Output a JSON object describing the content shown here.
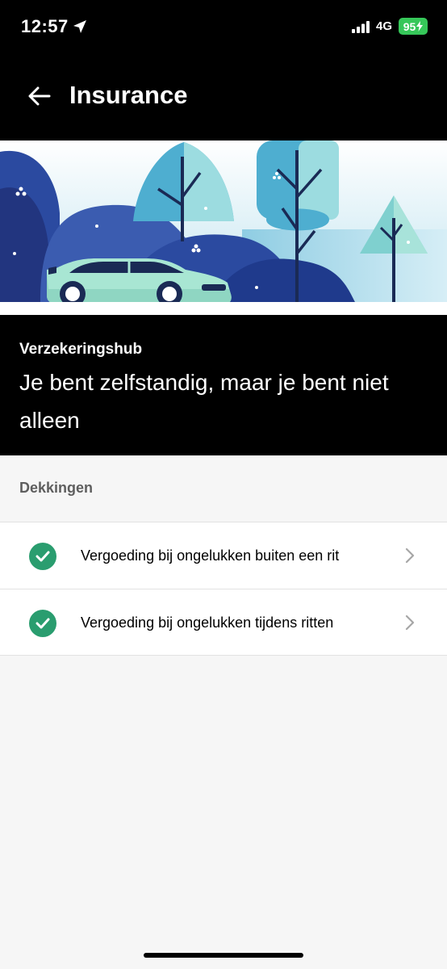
{
  "status_bar": {
    "time": "12:57",
    "network": "4G",
    "battery": "95",
    "icons": [
      "location-arrow-icon",
      "signal-bars-icon",
      "battery-charging-icon"
    ]
  },
  "nav": {
    "back_icon": "arrow-left-icon",
    "title": "Insurance"
  },
  "hero": {
    "illustration": "car-trees-illustration"
  },
  "banner": {
    "eyebrow": "Verzekeringshub",
    "headline": "Je bent zelfstandig, maar je bent niet alleen"
  },
  "coverages": {
    "section_title": "Dekkingen",
    "items": [
      {
        "label": "Vergoeding bij ongelukken buiten een rit",
        "icon": "check-circle-icon"
      },
      {
        "label": "Vergoeding bij ongelukken tijdens ritten",
        "icon": "check-circle-icon"
      }
    ]
  },
  "colors": {
    "accent_green": "#2a9d6f",
    "battery_green": "#36c759",
    "header_black": "#000000",
    "background": "#f6f6f6"
  }
}
